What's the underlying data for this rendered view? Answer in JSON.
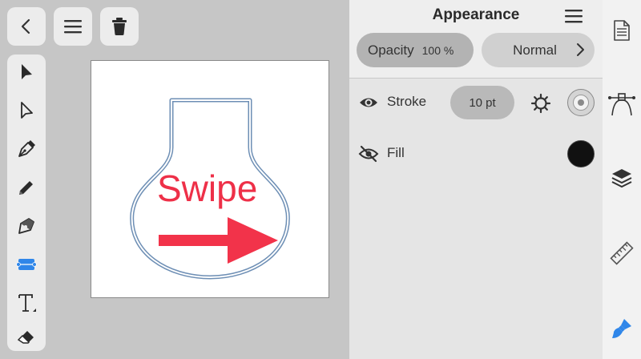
{
  "canvas": {
    "artwork_text": "Swipe",
    "artwork_text_color": "#ee3048",
    "arrow_color": "#f2334a",
    "outline_color": "#6e8fb5"
  },
  "top_buttons": [
    {
      "icon": "chevron-left-icon"
    },
    {
      "icon": "hamburger-menu-icon"
    },
    {
      "icon": "trash-icon"
    }
  ],
  "tools": [
    {
      "icon": "selection-arrow-icon",
      "selected": false
    },
    {
      "icon": "direct-selection-arrow-icon",
      "selected": false
    },
    {
      "icon": "pen-tool-icon",
      "selected": false
    },
    {
      "icon": "pencil-icon",
      "selected": false
    },
    {
      "icon": "node-tool-icon",
      "selected": false
    },
    {
      "icon": "shape-tool-icon",
      "selected": true
    },
    {
      "icon": "text-tool-icon",
      "selected": false
    },
    {
      "icon": "eraser-icon",
      "selected": false
    }
  ],
  "panel": {
    "title": "Appearance",
    "opacity_label": "Opacity",
    "opacity_value": "100 %",
    "blend_mode": "Normal",
    "stroke": {
      "label": "Stroke",
      "visible": true,
      "width": "10 pt",
      "color": "#d4d4d4"
    },
    "fill": {
      "label": "Fill",
      "visible": false,
      "color": "#111111"
    }
  },
  "right_sidebar": [
    {
      "icon": "document-icon",
      "active": false
    },
    {
      "icon": "bezier-path-icon",
      "active": false
    },
    {
      "icon": "layers-icon",
      "active": false
    },
    {
      "icon": "ruler-icon",
      "active": false
    },
    {
      "icon": "paintbrush-icon",
      "active": true
    }
  ],
  "accent_color": "#2f86e9"
}
